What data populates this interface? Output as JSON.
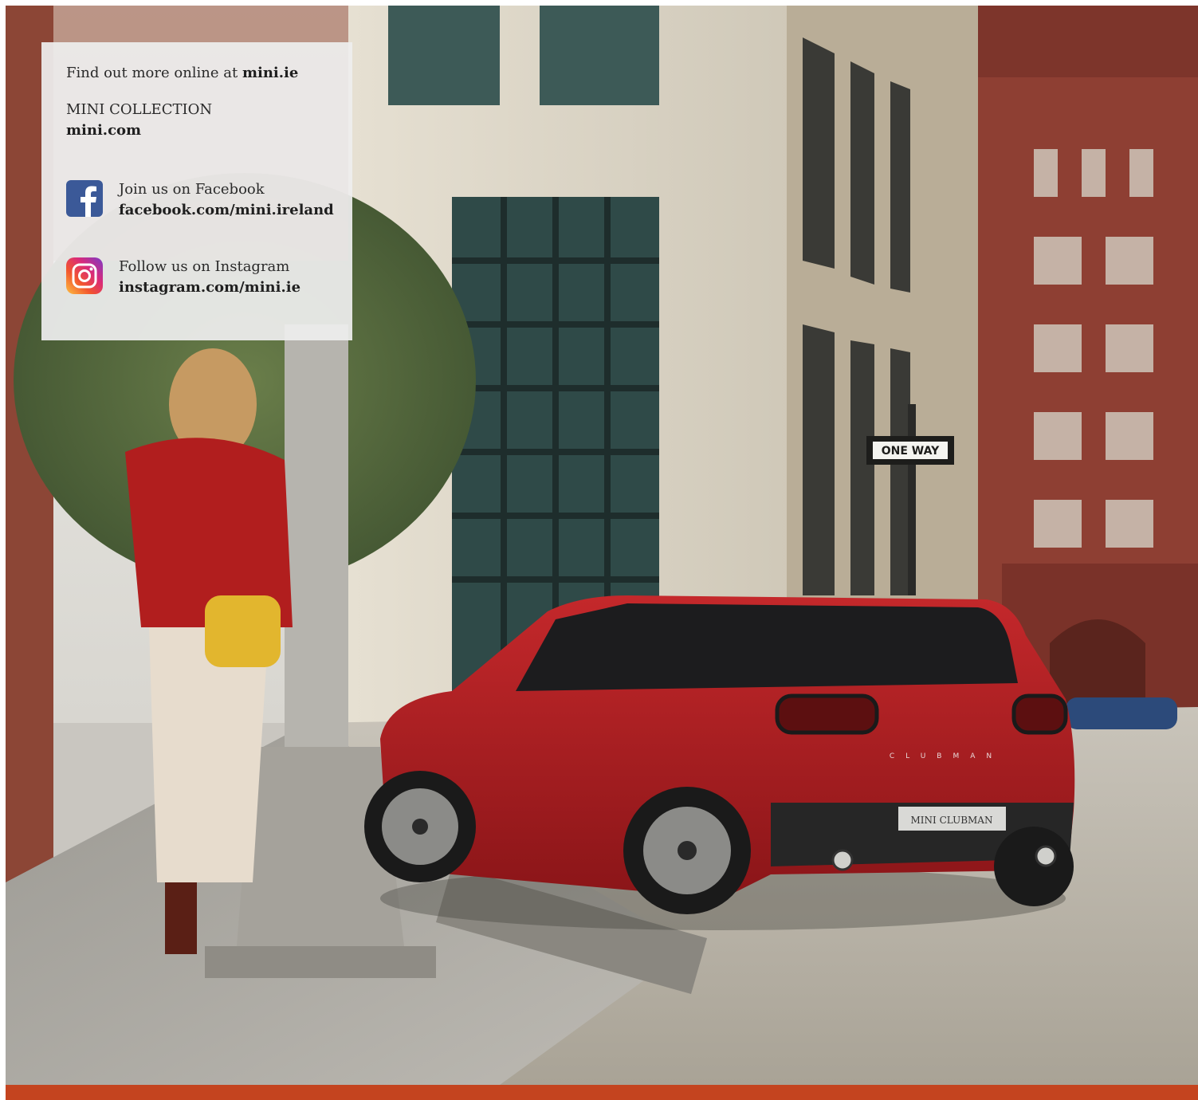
{
  "intro": {
    "text": "Find out more online at ",
    "link": "mini.ie"
  },
  "collection": {
    "label": "MINI COLLECTION",
    "link": "mini.com"
  },
  "facebook": {
    "label": "Join us on Facebook",
    "link": "facebook.com/mini.ireland",
    "icon": "facebook-icon",
    "color": "#3b5998"
  },
  "instagram": {
    "label": "Follow us on Instagram",
    "link": "instagram.com/mini.ie",
    "icon": "instagram-icon"
  },
  "photo": {
    "street_sign": "ONE WAY",
    "badge": "CLUBMAN",
    "plate": "MINI CLUBMAN"
  },
  "colors": {
    "accent_bar": "#c4441f",
    "car_red": "#b01e22",
    "brick": "#8e3f33"
  }
}
